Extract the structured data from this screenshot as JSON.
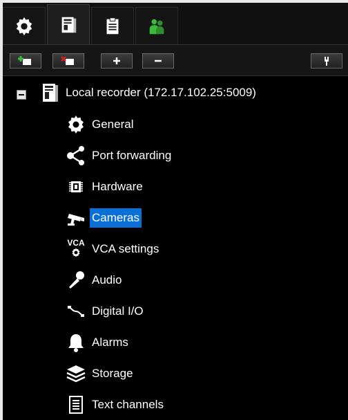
{
  "tabs": [
    {
      "name": "settings",
      "icon": "gear-icon"
    },
    {
      "name": "recorder",
      "icon": "server-icon"
    },
    {
      "name": "clipboard",
      "icon": "clipboard-icon"
    },
    {
      "name": "users",
      "icon": "users-icon"
    }
  ],
  "toolbar": {
    "buttons": [
      "add-recorder-icon",
      "remove-recorder-icon",
      "plus-icon",
      "minus-icon",
      "wrench-icon"
    ]
  },
  "tree": {
    "root_label": "Local recorder (172.17.102.25:5009)",
    "selected": "Cameras",
    "items": [
      {
        "label": "General",
        "icon": "gear-icon"
      },
      {
        "label": "Port forwarding",
        "icon": "share-icon"
      },
      {
        "label": "Hardware",
        "icon": "chip-icon"
      },
      {
        "label": "Cameras",
        "icon": "camera-icon"
      },
      {
        "label": "VCA settings",
        "icon": "vca-icon",
        "icon_text": "VCA"
      },
      {
        "label": "Audio",
        "icon": "microphone-icon"
      },
      {
        "label": "Digital I/O",
        "icon": "digital-io-icon"
      },
      {
        "label": "Alarms",
        "icon": "bell-icon"
      },
      {
        "label": "Storage",
        "icon": "layers-icon"
      },
      {
        "label": "Text channels",
        "icon": "list-icon"
      }
    ]
  },
  "colors": {
    "selection": "#0a6fd6",
    "accent_green": "#3cba3c",
    "accent_red": "#d62020"
  }
}
